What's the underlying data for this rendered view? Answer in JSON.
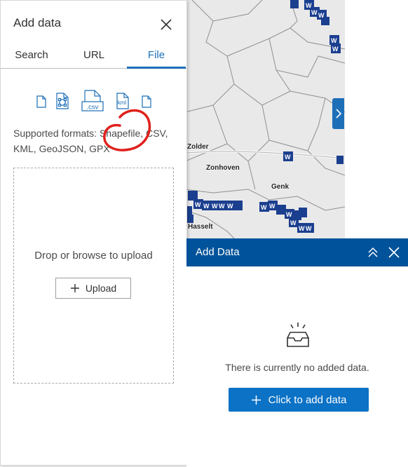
{
  "map": {
    "places": [
      "Zolder",
      "Zonhoven",
      "Genk",
      "Hasselt"
    ],
    "marker_glyph": "W",
    "marker_color": "#1b3f8f",
    "expand_icon": "chevron-right-icon"
  },
  "left_panel": {
    "title": "Add data",
    "close_icon": "close-icon",
    "tabs": [
      {
        "label": "Search",
        "active": false
      },
      {
        "label": "URL",
        "active": false
      },
      {
        "label": "File",
        "active": true
      }
    ],
    "format_icons": [
      "file-icon",
      "geojson-file-icon",
      "csv-file-icon",
      "kml-file-icon",
      "file-icon"
    ],
    "csv_label": ".csv",
    "kml_label": "kml",
    "supported_formats": "Supported formats: Shapefile, CSV, KML, GeoJSON, GPX",
    "dropzone_text": "Drop or browse to upload",
    "upload_label": "Upload",
    "accent_color": "#1d6fb8",
    "annotation_color": "#e0201b"
  },
  "right_panel": {
    "title": "Add Data",
    "header_color": "#00539a",
    "collapse_icon": "double-chevron-up-icon",
    "close_icon": "close-icon",
    "empty_icon": "inbox-icon",
    "empty_message": "There is currently no added data.",
    "add_button_label": "Click to add data",
    "button_color": "#0b72c6"
  }
}
